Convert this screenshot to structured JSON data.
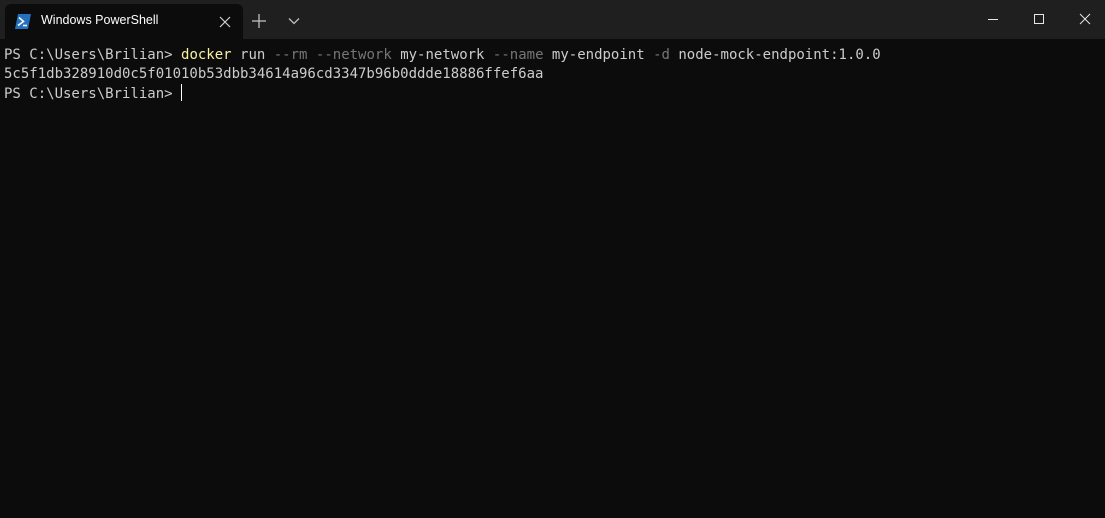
{
  "window": {
    "tab_title": "Windows PowerShell",
    "tab_icon": "powershell-icon",
    "controls": [
      "minimize-icon",
      "maximize-icon",
      "close-icon"
    ],
    "accent_color": "#012456"
  },
  "terminal": {
    "lines": [
      {
        "prompt": "PS C:\\Users\\Brilian> ",
        "tokens": [
          {
            "text": "docker",
            "kind": "command"
          },
          {
            "text": " run ",
            "kind": "arg"
          },
          {
            "text": "--rm",
            "kind": "param"
          },
          {
            "text": " ",
            "kind": "arg"
          },
          {
            "text": "--network",
            "kind": "param"
          },
          {
            "text": " my-network ",
            "kind": "arg"
          },
          {
            "text": "--name",
            "kind": "param"
          },
          {
            "text": " my-endpoint ",
            "kind": "arg"
          },
          {
            "text": "-d",
            "kind": "param"
          },
          {
            "text": " node-mock-endpoint:1.0.0",
            "kind": "arg"
          }
        ]
      },
      {
        "output": "5c5f1db328910d0c5f01010b53dbb34614a96cd3347b96b0ddde18886ffef6aa"
      },
      {
        "prompt": "PS C:\\Users\\Brilian> ",
        "cursor": true
      }
    ],
    "colors": {
      "background": "#0c0c0c",
      "foreground": "#cccccc",
      "command": "#f9f1a5",
      "parameter": "#767676"
    }
  }
}
